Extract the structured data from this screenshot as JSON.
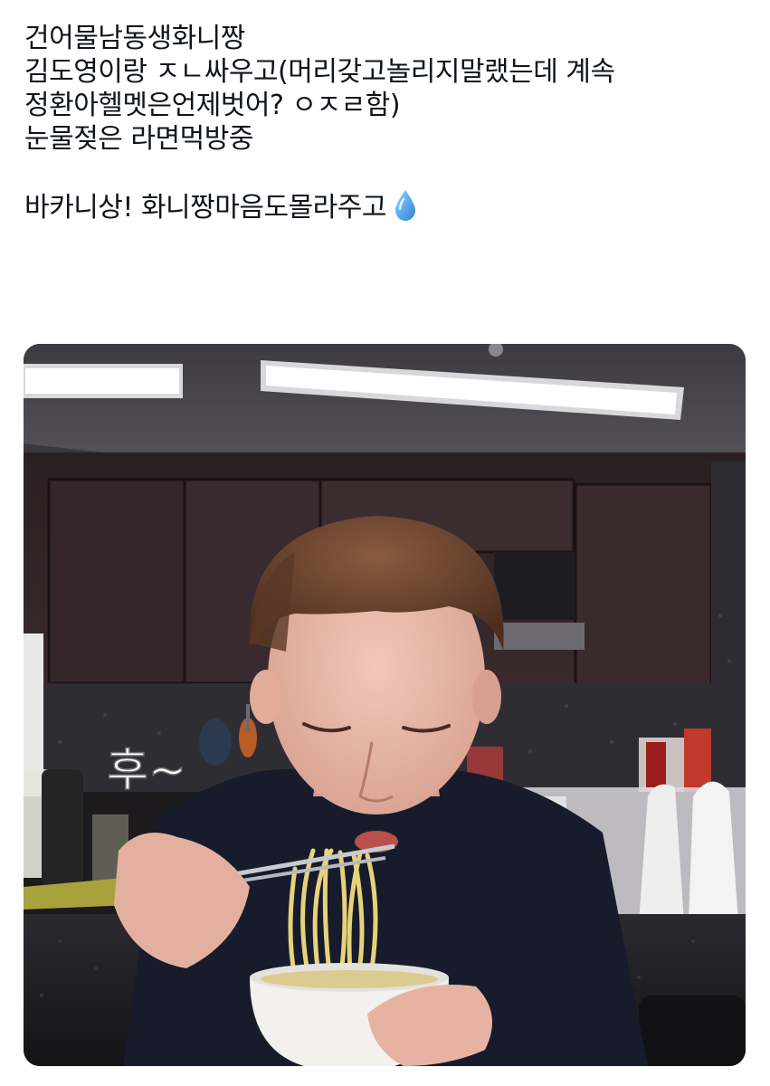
{
  "tweet": {
    "lines": [
      "건어물남동생화니짱",
      "김도영이랑 ㅈㄴ싸우고(머리갖고놀리지말랬는데 계속",
      "정환아헬멧은언제벗어? ㅇㅈㄹ함)",
      "눈물젖은 라면먹방중"
    ],
    "last_line": "바카니상! 화니짱마음도몰라주고",
    "emoji": "droplet-icon"
  },
  "media": {
    "overlay_text": "후~",
    "icon": "photo-image"
  },
  "colors": {
    "text": "#0f1419",
    "droplet": "#4aa8e6"
  }
}
